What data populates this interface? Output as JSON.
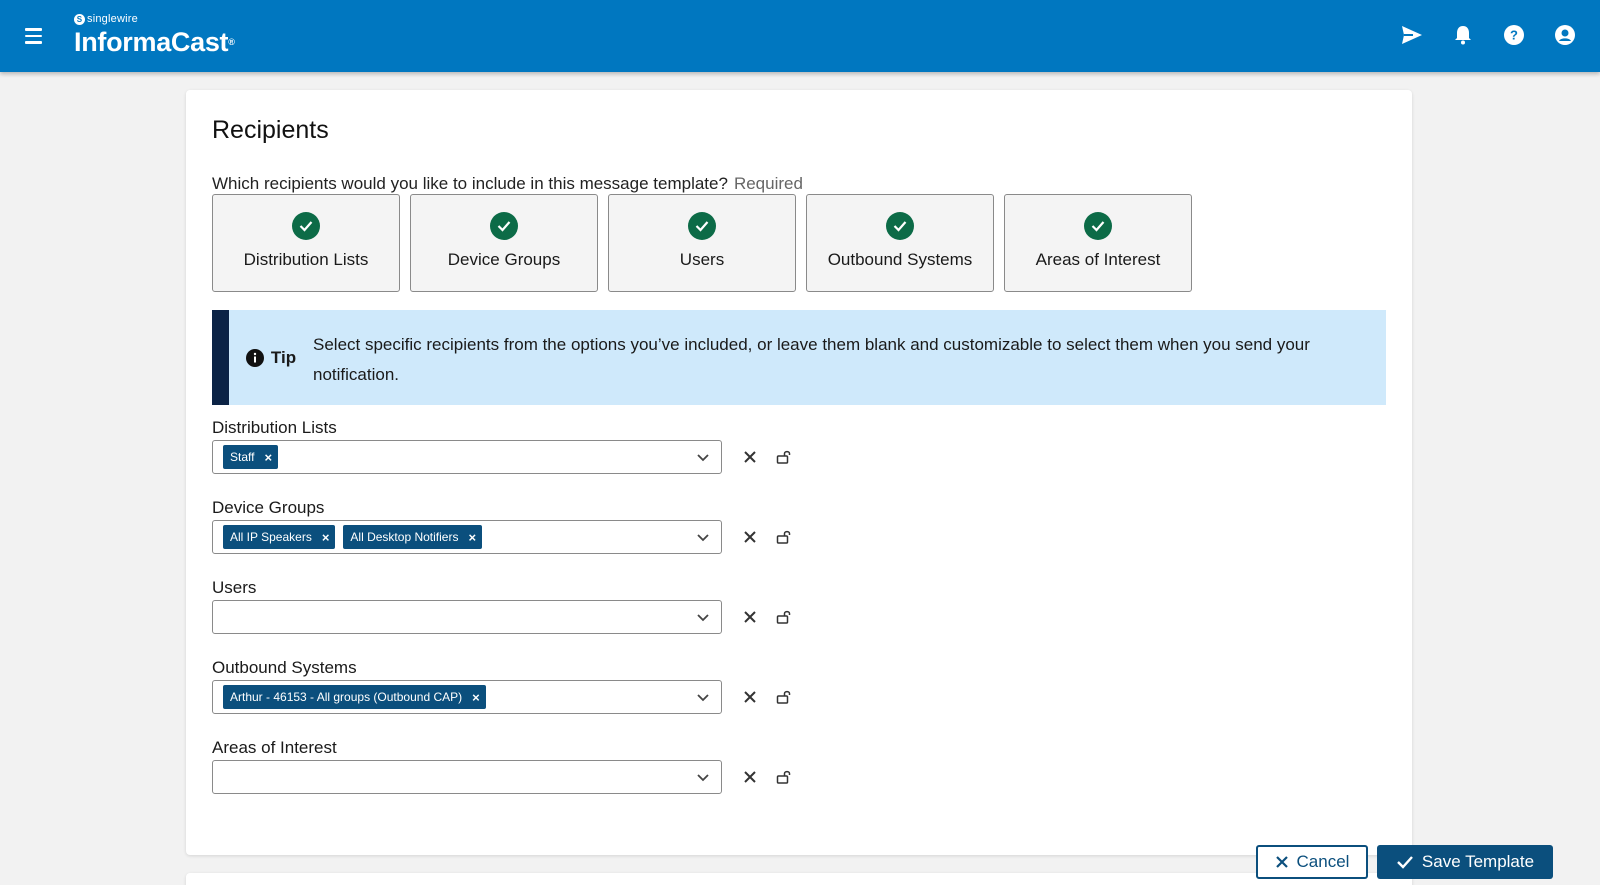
{
  "header": {
    "brand_small": "singlewire",
    "brand_big": "InformaCast",
    "brand_mark": "®",
    "icons": [
      "menu-icon",
      "send-icon",
      "bell-icon",
      "help-icon",
      "account-icon"
    ],
    "bg_color": "#0077c0"
  },
  "recipients": {
    "title": "Recipients",
    "question": "Which recipients would you like to include in this message template?",
    "required": "Required",
    "types": [
      {
        "label": "Distribution Lists",
        "selected": true
      },
      {
        "label": "Device Groups",
        "selected": true
      },
      {
        "label": "Users",
        "selected": true
      },
      {
        "label": "Outbound Systems",
        "selected": true
      },
      {
        "label": "Areas of Interest",
        "selected": true
      }
    ],
    "tip": {
      "label": "Tip",
      "text": "Select specific recipients from the options you’ve included, or leave them blank and customizable to select them when you send your notification."
    },
    "fields": [
      {
        "label": "Distribution Lists",
        "chips": [
          "Staff"
        ]
      },
      {
        "label": "Device Groups",
        "chips": [
          "All IP Speakers",
          "All Desktop Notifiers"
        ]
      },
      {
        "label": "Users",
        "chips": []
      },
      {
        "label": "Outbound Systems",
        "chips": [
          "Arthur - 46153 - All groups (Outbound CAP)"
        ]
      },
      {
        "label": "Areas of Interest",
        "chips": []
      }
    ]
  },
  "footer": {
    "cancel_label": "Cancel",
    "save_label": "Save Template"
  },
  "colors": {
    "check_green": "#0c6b47",
    "chip_blue": "#0b4f7d",
    "tip_bg": "#cfe9fb",
    "tip_bar": "#0b2345"
  }
}
